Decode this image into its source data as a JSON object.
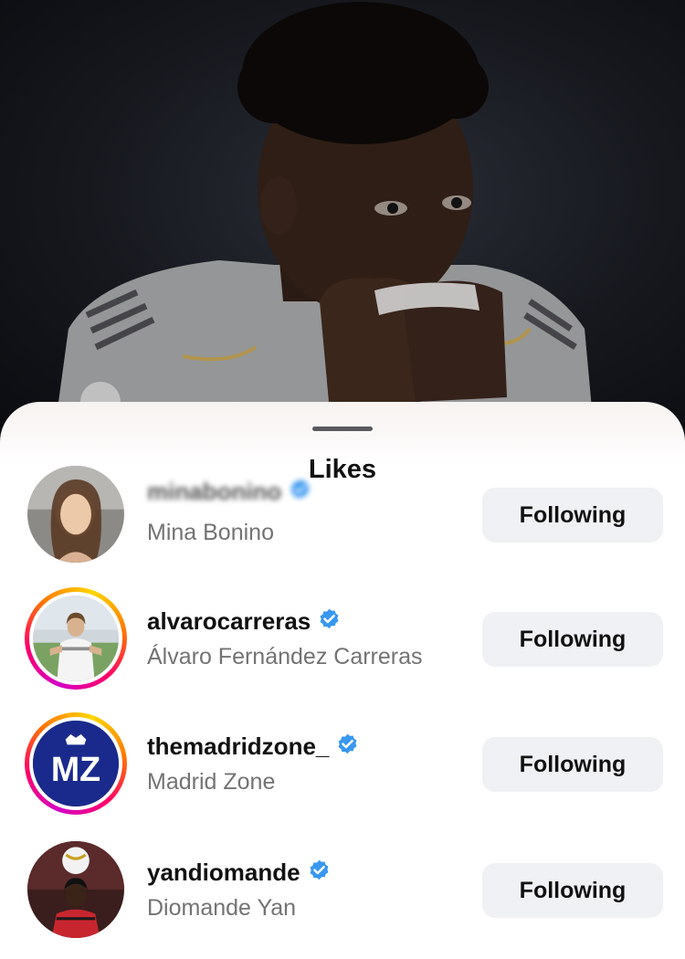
{
  "sheet": {
    "title": "Likes"
  },
  "likes": [
    {
      "username": "minabonino",
      "full_name": "Mina Bonino",
      "verified": true,
      "story_ring": false,
      "button_label": "Following"
    },
    {
      "username": "alvarocarreras",
      "full_name": "Álvaro Fernández Carreras",
      "verified": true,
      "story_ring": true,
      "button_label": "Following"
    },
    {
      "username": "themadridzone_",
      "full_name": "Madrid Zone",
      "verified": true,
      "story_ring": true,
      "avatar_text": "MZ",
      "button_label": "Following"
    },
    {
      "username": "yandiomande",
      "full_name": "Diomande Yan",
      "verified": true,
      "story_ring": false,
      "button_label": "Following"
    }
  ],
  "colors": {
    "verified_badge": "#3897f0",
    "button_bg": "#eff1f4",
    "secondary_text": "#737373",
    "madrid_zone_blue": "#1a2a8c"
  }
}
